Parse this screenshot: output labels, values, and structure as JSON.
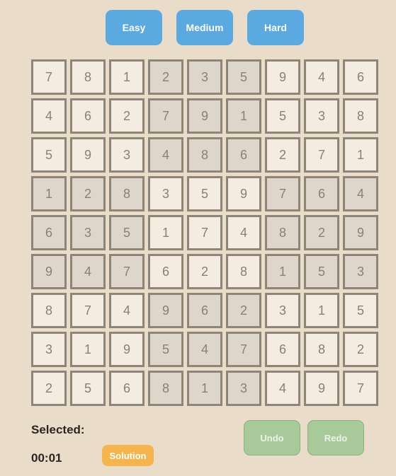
{
  "difficulty": {
    "easy_label": "Easy",
    "medium_label": "Medium",
    "hard_label": "Hard"
  },
  "board": {
    "rows": [
      [
        "7",
        "8",
        "1",
        "2",
        "3",
        "5",
        "9",
        "4",
        "6"
      ],
      [
        "4",
        "6",
        "2",
        "7",
        "9",
        "1",
        "5",
        "3",
        "8"
      ],
      [
        "5",
        "9",
        "3",
        "4",
        "8",
        "6",
        "2",
        "7",
        "1"
      ],
      [
        "1",
        "2",
        "8",
        "3",
        "5",
        "9",
        "7",
        "6",
        "4"
      ],
      [
        "6",
        "3",
        "5",
        "1",
        "7",
        "4",
        "8",
        "2",
        "9"
      ],
      [
        "9",
        "4",
        "7",
        "6",
        "2",
        "8",
        "1",
        "5",
        "3"
      ],
      [
        "8",
        "7",
        "4",
        "9",
        "6",
        "2",
        "3",
        "1",
        "5"
      ],
      [
        "3",
        "1",
        "9",
        "5",
        "4",
        "7",
        "6",
        "8",
        "2"
      ],
      [
        "2",
        "5",
        "6",
        "8",
        "1",
        "3",
        "4",
        "9",
        "7"
      ]
    ]
  },
  "status": {
    "selected_label": "Selected:",
    "timer": "00:01"
  },
  "controls": {
    "solution_label": "Solution",
    "undo_label": "Undo",
    "redo_label": "Redo"
  },
  "colors": {
    "background": "#e9dcc9",
    "difficulty_button": "#5aa9e1",
    "cell_light": "#f4ece1",
    "cell_dark": "#dfd6cb",
    "cell_border": "#8c8578",
    "solution_button": "#f6b44d",
    "undo_redo_button": "#a8c99a"
  }
}
